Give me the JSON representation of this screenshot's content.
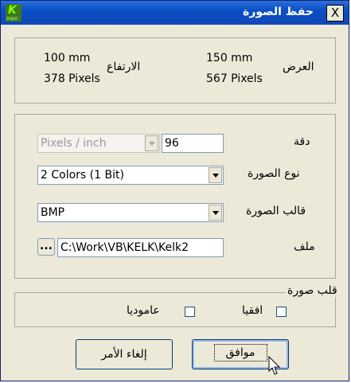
{
  "window": {
    "title": "حفظ الصورة",
    "close_label": "X",
    "icon_letter": "K",
    "icon_small_text": "zopo"
  },
  "dimensions": {
    "height_label": "الارتفاع",
    "height_mm": "100 mm",
    "height_px": "378 Pixels",
    "width_label": "العرض",
    "width_mm": "150 mm",
    "width_px": "567 Pixels"
  },
  "settings": {
    "resolution_label": "دقة",
    "resolution_unit": "Pixels / inch",
    "resolution_value": "96",
    "type_label": "نوع الصورة",
    "type_value": "2 Colors (1 Bit)",
    "format_label": "قالب الصورة",
    "format_value": "BMP",
    "file_label": "ملف",
    "file_browse": "...",
    "file_path": "C:\\Work\\VB\\KELK\\Kelk2"
  },
  "flip": {
    "legend": "قلب صورة",
    "horizontal": "افقيا",
    "vertical": "عاموديا"
  },
  "buttons": {
    "ok": "موافق",
    "cancel": "إلغاء الأمر"
  }
}
